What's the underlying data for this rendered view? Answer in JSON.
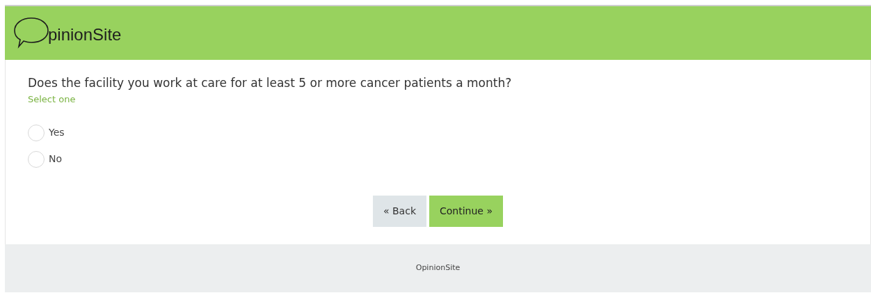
{
  "header": {
    "logo_text": "pinionSite"
  },
  "question": {
    "text": "Does the facility you work at care for at least 5 or more cancer patients a month?",
    "hint": "Select one",
    "options": [
      {
        "label": "Yes",
        "selected": false
      },
      {
        "label": "No",
        "selected": false
      }
    ]
  },
  "buttons": [
    {
      "label": "« Back",
      "kind": "back"
    },
    {
      "label": "Continue »",
      "kind": "continue"
    }
  ],
  "footer": {
    "text": "OpinionSite"
  }
}
